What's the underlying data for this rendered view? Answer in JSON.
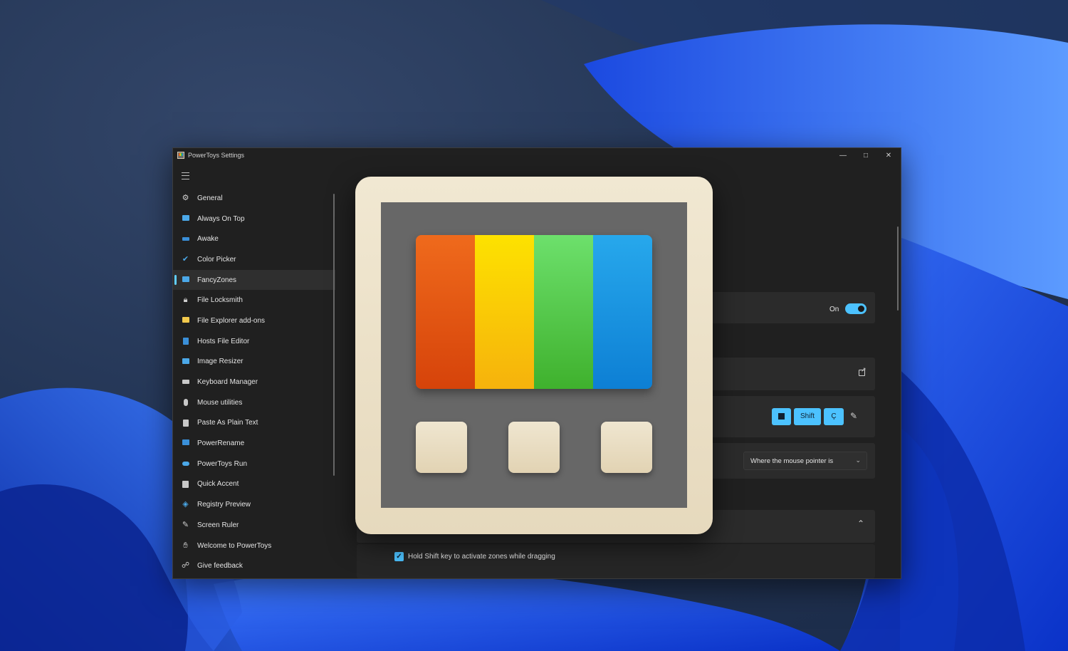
{
  "window": {
    "title": "PowerToys Settings",
    "controls": {
      "minimize": "—",
      "maximize": "□",
      "close": "✕"
    }
  },
  "sidebar": {
    "items": [
      {
        "label": "General",
        "icon": "gear-icon"
      },
      {
        "label": "Always On Top",
        "icon": "always-on-top-icon"
      },
      {
        "label": "Awake",
        "icon": "awake-icon"
      },
      {
        "label": "Color Picker",
        "icon": "color-picker-icon"
      },
      {
        "label": "FancyZones",
        "icon": "fancyzones-icon",
        "selected": true
      },
      {
        "label": "File Locksmith",
        "icon": "lock-icon"
      },
      {
        "label": "File Explorer add-ons",
        "icon": "folder-icon"
      },
      {
        "label": "Hosts File Editor",
        "icon": "document-icon"
      },
      {
        "label": "Image Resizer",
        "icon": "image-resizer-icon"
      },
      {
        "label": "Keyboard Manager",
        "icon": "keyboard-icon"
      },
      {
        "label": "Mouse utilities",
        "icon": "mouse-icon"
      },
      {
        "label": "Paste As Plain Text",
        "icon": "clipboard-icon"
      },
      {
        "label": "PowerRename",
        "icon": "rename-icon"
      },
      {
        "label": "PowerToys Run",
        "icon": "run-icon"
      },
      {
        "label": "Quick Accent",
        "icon": "accent-icon"
      },
      {
        "label": "Registry Preview",
        "icon": "registry-icon"
      },
      {
        "label": "Screen Ruler",
        "icon": "ruler-icon"
      },
      {
        "label": "Welcome to PowerToys",
        "icon": "welcome-icon"
      },
      {
        "label": "Give feedback",
        "icon": "feedback-icon"
      }
    ]
  },
  "content": {
    "enable_toggle": {
      "label": "On",
      "state": true
    },
    "hotkey": {
      "keys": [
        "Win",
        "Shift",
        "Ç"
      ]
    },
    "location_dropdown": {
      "selected": "Where the mouse pointer is"
    },
    "checkbox": {
      "label": "Hold Shift key to activate zones while dragging",
      "checked": true
    }
  },
  "colors": {
    "accent": "#4cc2ff",
    "logo_bars": [
      "#e0501a",
      "#f5c518",
      "#55c238",
      "#1f8fe0"
    ],
    "logo_frame": "#e6d9bd"
  }
}
